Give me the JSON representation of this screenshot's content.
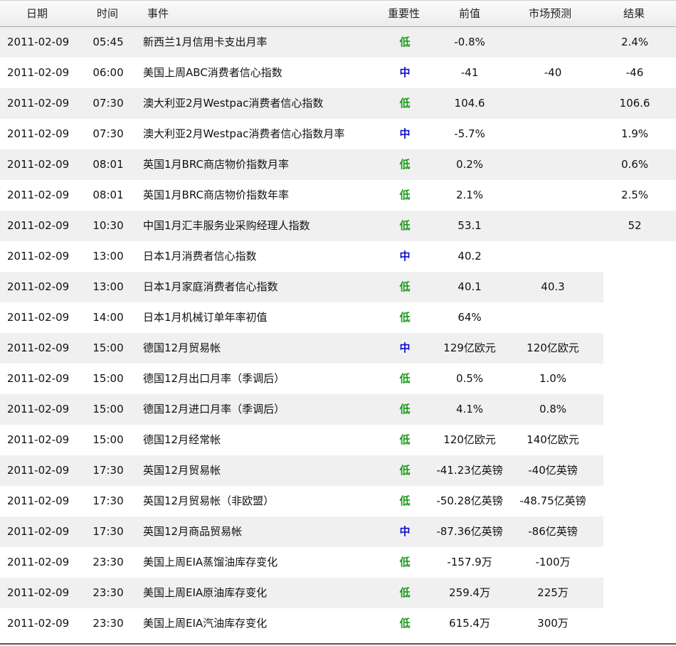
{
  "colors": {
    "low": "#1a9a1a",
    "mid": "#1010c8",
    "shade": "#f0f0f0"
  },
  "header": {
    "date": "日期",
    "time": "时间",
    "event": "事件",
    "importance": "重要性",
    "previous": "前值",
    "forecast": "市场预测",
    "result": "结果"
  },
  "rows": [
    {
      "date": "2011-02-09",
      "time": "05:45",
      "event": "新西兰1月信用卡支出月率",
      "importance": "低",
      "level": "low",
      "previous": "-0.8%",
      "forecast": "",
      "result": "2.4%"
    },
    {
      "date": "2011-02-09",
      "time": "06:00",
      "event": "美国上周ABC消费者信心指数",
      "importance": "中",
      "level": "mid",
      "previous": "-41",
      "forecast": "-40",
      "result": "-46"
    },
    {
      "date": "2011-02-09",
      "time": "07:30",
      "event": "澳大利亚2月Westpac消费者信心指数",
      "importance": "低",
      "level": "low",
      "previous": "104.6",
      "forecast": "",
      "result": "106.6"
    },
    {
      "date": "2011-02-09",
      "time": "07:30",
      "event": "澳大利亚2月Westpac消费者信心指数月率",
      "importance": "中",
      "level": "mid",
      "previous": "-5.7%",
      "forecast": "",
      "result": "1.9%"
    },
    {
      "date": "2011-02-09",
      "time": "08:01",
      "event": "英国1月BRC商店物价指数月率",
      "importance": "低",
      "level": "low",
      "previous": "0.2%",
      "forecast": "",
      "result": "0.6%"
    },
    {
      "date": "2011-02-09",
      "time": "08:01",
      "event": "英国1月BRC商店物价指数年率",
      "importance": "低",
      "level": "low",
      "previous": "2.1%",
      "forecast": "",
      "result": "2.5%"
    },
    {
      "date": "2011-02-09",
      "time": "10:30",
      "event": "中国1月汇丰服务业采购经理人指数",
      "importance": "低",
      "level": "low",
      "previous": "53.1",
      "forecast": "",
      "result": "52"
    },
    {
      "date": "2011-02-09",
      "time": "13:00",
      "event": "日本1月消费者信心指数",
      "importance": "中",
      "level": "mid",
      "previous": "40.2",
      "forecast": "",
      "result": ""
    },
    {
      "date": "2011-02-09",
      "time": "13:00",
      "event": "日本1月家庭消费者信心指数",
      "importance": "低",
      "level": "low",
      "previous": "40.1",
      "forecast": "40.3",
      "result": ""
    },
    {
      "date": "2011-02-09",
      "time": "14:00",
      "event": "日本1月机械订单年率初值",
      "importance": "低",
      "level": "low",
      "previous": "64%",
      "forecast": "",
      "result": ""
    },
    {
      "date": "2011-02-09",
      "time": "15:00",
      "event": "德国12月贸易帐",
      "importance": "中",
      "level": "mid",
      "previous": "129亿欧元",
      "forecast": "120亿欧元",
      "result": ""
    },
    {
      "date": "2011-02-09",
      "time": "15:00",
      "event": "德国12月出口月率（季调后）",
      "importance": "低",
      "level": "low",
      "previous": "0.5%",
      "forecast": "1.0%",
      "result": ""
    },
    {
      "date": "2011-02-09",
      "time": "15:00",
      "event": "德国12月进口月率（季调后）",
      "importance": "低",
      "level": "low",
      "previous": "4.1%",
      "forecast": "0.8%",
      "result": ""
    },
    {
      "date": "2011-02-09",
      "time": "15:00",
      "event": "德国12月经常帐",
      "importance": "低",
      "level": "low",
      "previous": "120亿欧元",
      "forecast": "140亿欧元",
      "result": ""
    },
    {
      "date": "2011-02-09",
      "time": "17:30",
      "event": "英国12月贸易帐",
      "importance": "低",
      "level": "low",
      "previous": "-41.23亿英镑",
      "forecast": "-40亿英镑",
      "result": ""
    },
    {
      "date": "2011-02-09",
      "time": "17:30",
      "event": "英国12月贸易帐（非欧盟）",
      "importance": "低",
      "level": "low",
      "previous": "-50.28亿英镑",
      "forecast": "-48.75亿英镑",
      "result": ""
    },
    {
      "date": "2011-02-09",
      "time": "17:30",
      "event": "英国12月商品贸易帐",
      "importance": "中",
      "level": "mid",
      "previous": "-87.36亿英镑",
      "forecast": "-86亿英镑",
      "result": ""
    },
    {
      "date": "2011-02-09",
      "time": "23:30",
      "event": "美国上周EIA蒸馏油库存变化",
      "importance": "低",
      "level": "low",
      "previous": "-157.9万",
      "forecast": "-100万",
      "result": ""
    },
    {
      "date": "2011-02-09",
      "time": "23:30",
      "event": "美国上周EIA原油库存变化",
      "importance": "低",
      "level": "low",
      "previous": "259.4万",
      "forecast": "225万",
      "result": ""
    },
    {
      "date": "2011-02-09",
      "time": "23:30",
      "event": "美国上周EIA汽油库存变化",
      "importance": "低",
      "level": "low",
      "previous": "615.4万",
      "forecast": "300万",
      "result": ""
    }
  ]
}
